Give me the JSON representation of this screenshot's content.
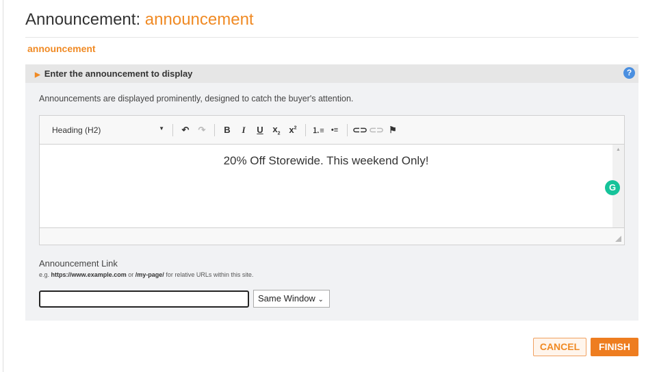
{
  "header": {
    "title_prefix": "Announcement:",
    "title_name": "announcement",
    "subtitle": "announcement"
  },
  "section": {
    "title": "Enter the announcement to display",
    "help_icon": "?"
  },
  "panel": {
    "description": "Announcements are displayed prominently, designed to catch the buyer's attention."
  },
  "editor": {
    "format": "Heading (H2)",
    "content": "20% Off Storewide. This weekend Only!"
  },
  "link": {
    "label": "Announcement Link",
    "hint_prefix": "e.g.",
    "hint_url": "https://www.example.com",
    "hint_or": "or",
    "hint_path": "/my-page/",
    "hint_suffix": "for relative URLs within this site.",
    "value": "",
    "target": "Same Window"
  },
  "buttons": {
    "cancel": "CANCEL",
    "finish": "FINISH"
  },
  "colors": {
    "accent": "#f08a24",
    "finish": "#ee7d20"
  }
}
